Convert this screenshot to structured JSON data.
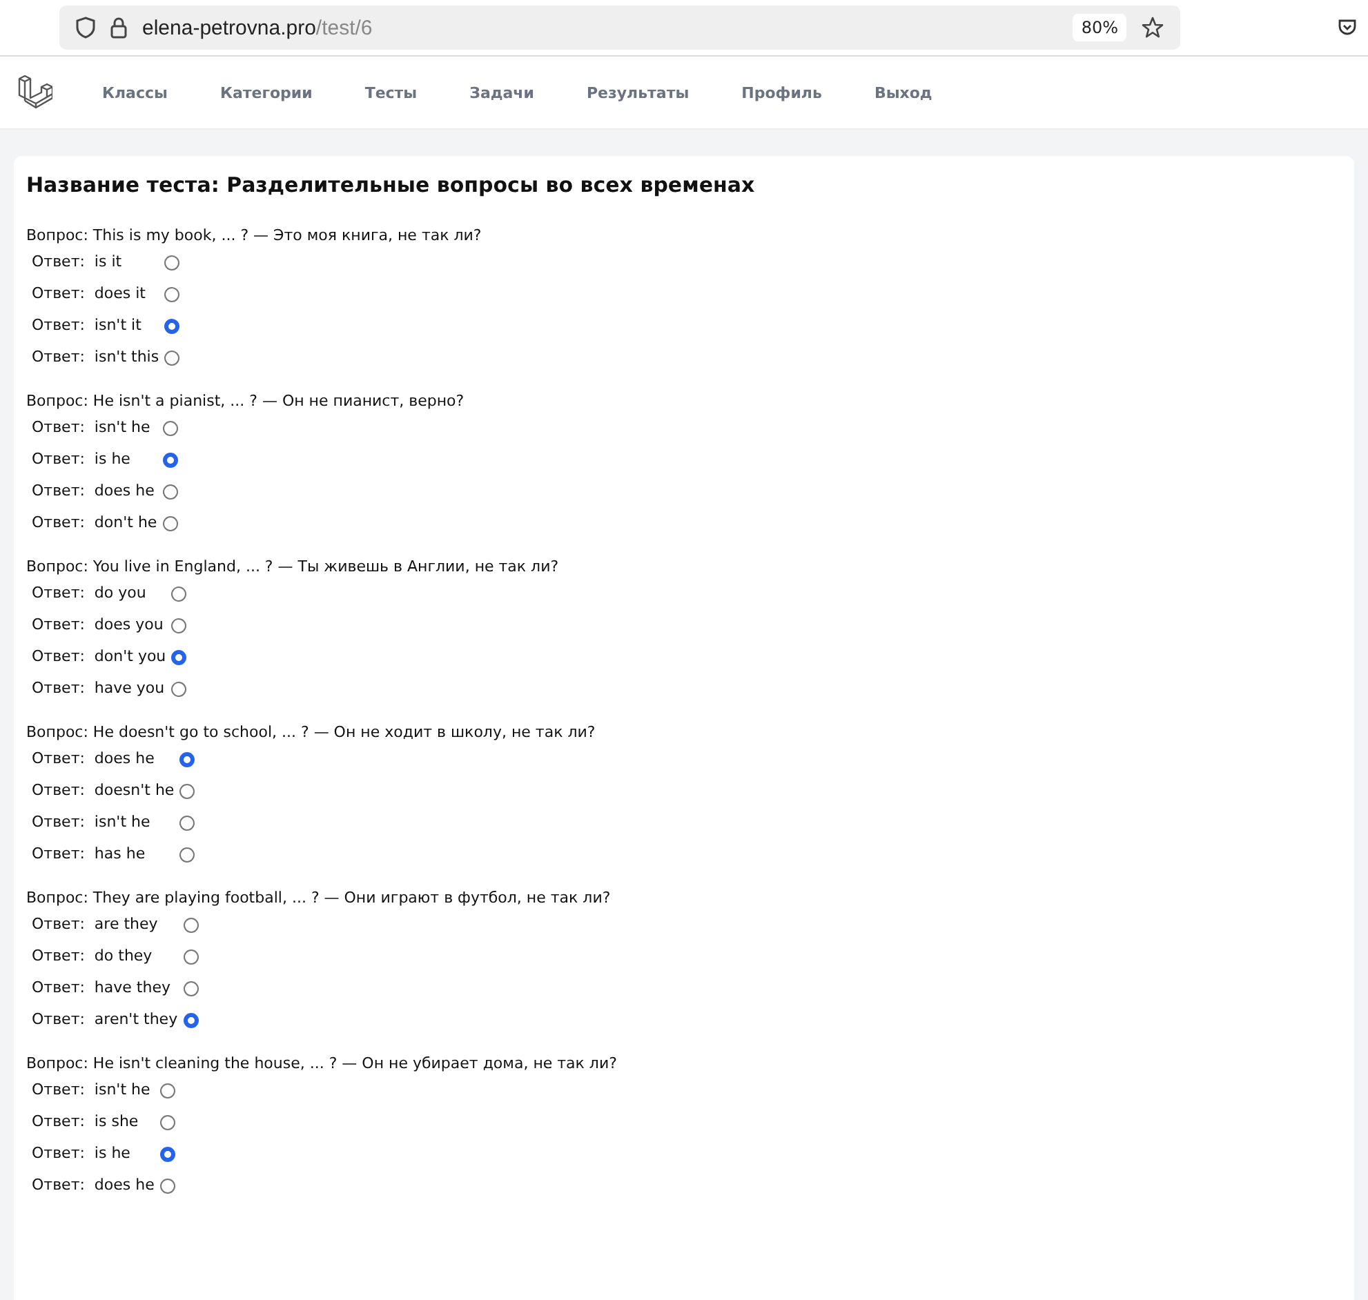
{
  "browser": {
    "url_host": "elena-petrovna.pro",
    "url_path": "/test/6",
    "zoom": "80%"
  },
  "nav": {
    "items": [
      {
        "label": "Классы"
      },
      {
        "label": "Категории"
      },
      {
        "label": "Тесты"
      },
      {
        "label": "Задачи"
      },
      {
        "label": "Результаты"
      },
      {
        "label": "Профиль"
      },
      {
        "label": "Выход"
      }
    ]
  },
  "test": {
    "title": "Название теста: Разделительные вопросы во всех временах",
    "questions": [
      {
        "text": "Вопрос: This is my book, ... ? — Это моя книга, не так ли?",
        "answers": [
          {
            "label": "Ответ:  is it",
            "selected": false
          },
          {
            "label": "Ответ:  does it",
            "selected": false
          },
          {
            "label": "Ответ:  isn't it",
            "selected": true
          },
          {
            "label": "Ответ:  isn't this",
            "selected": false
          }
        ]
      },
      {
        "text": "Вопрос: He isn't a pianist, ... ? — Он не пианист, верно?",
        "answers": [
          {
            "label": "Ответ:  isn't he",
            "selected": false
          },
          {
            "label": "Ответ:  is he",
            "selected": true
          },
          {
            "label": "Ответ:  does he",
            "selected": false
          },
          {
            "label": "Ответ:  don't he",
            "selected": false
          }
        ]
      },
      {
        "text": "Вопрос: You live in England, ... ? — Ты живешь в Англии, не так ли?",
        "answers": [
          {
            "label": "Ответ:  do you",
            "selected": false
          },
          {
            "label": "Ответ:  does you",
            "selected": false
          },
          {
            "label": "Ответ:  don't you",
            "selected": true
          },
          {
            "label": "Ответ:  have you",
            "selected": false
          }
        ]
      },
      {
        "text": "Вопрос: He doesn't go to school, ... ? — Он не ходит в школу, не так ли?",
        "answers": [
          {
            "label": "Ответ:  does he",
            "selected": true
          },
          {
            "label": "Ответ:  doesn't he",
            "selected": false
          },
          {
            "label": "Ответ:  isn't he",
            "selected": false
          },
          {
            "label": "Ответ:  has he",
            "selected": false
          }
        ]
      },
      {
        "text": "Вопрос: They are playing football, ... ? — Они играют в футбол, не так ли?",
        "answers": [
          {
            "label": "Ответ:  are they",
            "selected": false
          },
          {
            "label": "Ответ:  do they",
            "selected": false
          },
          {
            "label": "Ответ:  have they",
            "selected": false
          },
          {
            "label": "Ответ:  aren't they",
            "selected": true
          }
        ]
      },
      {
        "text": "Вопрос: He isn't cleaning the house, ... ? — Он не убирает дома, не так ли?",
        "answers": [
          {
            "label": "Ответ:  isn't he",
            "selected": false
          },
          {
            "label": "Ответ:  is she",
            "selected": false
          },
          {
            "label": "Ответ:  is he",
            "selected": true
          },
          {
            "label": "Ответ:  does he",
            "selected": false
          }
        ]
      }
    ]
  }
}
